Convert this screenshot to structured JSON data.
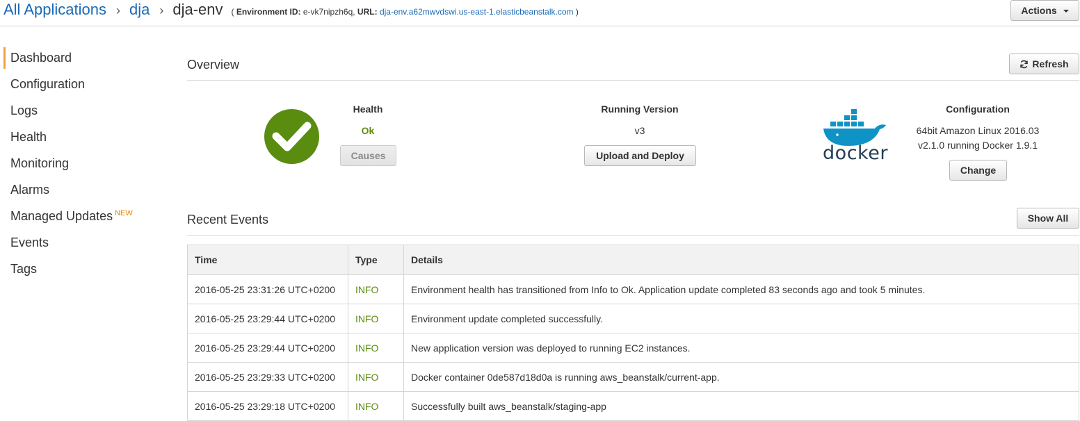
{
  "breadcrumb": {
    "root": "All Applications",
    "application": "dja",
    "environment": "dja-env",
    "env_id_label": "Environment ID:",
    "env_id": "e-vk7nipzh6q,",
    "url_label": "URL:",
    "url": "dja-env.a62mwvdswi.us-east-1.elasticbeanstalk.com",
    "open_paren": "(",
    "close_paren": ")"
  },
  "header": {
    "actions_label": "Actions"
  },
  "sidebar": {
    "items": [
      {
        "label": "Dashboard"
      },
      {
        "label": "Configuration"
      },
      {
        "label": "Logs"
      },
      {
        "label": "Health"
      },
      {
        "label": "Monitoring"
      },
      {
        "label": "Alarms"
      },
      {
        "label": "Managed Updates",
        "badge": "NEW"
      },
      {
        "label": "Events"
      },
      {
        "label": "Tags"
      }
    ]
  },
  "overview": {
    "title": "Overview",
    "refresh_label": "Refresh",
    "health": {
      "heading": "Health",
      "status": "Ok",
      "causes_label": "Causes",
      "status_color": "#5a8d0f"
    },
    "running_version": {
      "heading": "Running Version",
      "value": "v3",
      "upload_label": "Upload and Deploy"
    },
    "configuration": {
      "heading": "Configuration",
      "line1": "64bit Amazon Linux 2016.03",
      "line2": "v2.1.0 running Docker 1.9.1",
      "change_label": "Change",
      "logo_text": "docker"
    }
  },
  "events": {
    "title": "Recent Events",
    "show_all_label": "Show All",
    "columns": [
      "Time",
      "Type",
      "Details"
    ],
    "rows": [
      {
        "time": "2016-05-25 23:31:26 UTC+0200",
        "type": "INFO",
        "details": "Environment health has transitioned from Info to Ok. Application update completed 83 seconds ago and took 5 minutes."
      },
      {
        "time": "2016-05-25 23:29:44 UTC+0200",
        "type": "INFO",
        "details": "Environment update completed successfully."
      },
      {
        "time": "2016-05-25 23:29:44 UTC+0200",
        "type": "INFO",
        "details": "New application version was deployed to running EC2 instances."
      },
      {
        "time": "2016-05-25 23:29:33 UTC+0200",
        "type": "INFO",
        "details": "Docker container 0de587d18d0a is running aws_beanstalk/current-app."
      },
      {
        "time": "2016-05-25 23:29:18 UTC+0200",
        "type": "INFO",
        "details": "Successfully built aws_beanstalk/staging-app"
      }
    ]
  },
  "colors": {
    "link": "#1a6ab5",
    "ok_green": "#5a8d0f",
    "active_accent": "#f0a33c",
    "new_badge": "#e68a00",
    "docker_blue": "#0f92c5"
  }
}
